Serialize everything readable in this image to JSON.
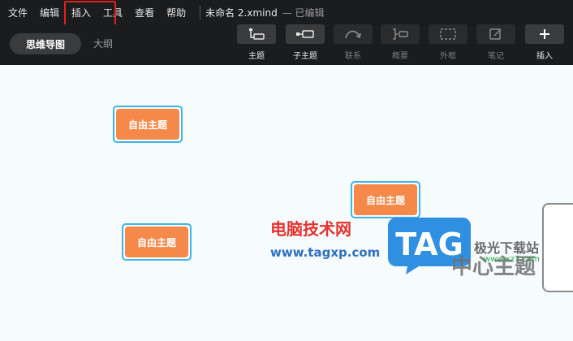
{
  "menu": {
    "items": [
      "文件",
      "编辑",
      "插入",
      "工具",
      "查看",
      "帮助"
    ],
    "doc_title": "未命名 2.xmind",
    "doc_status": "— 已编辑"
  },
  "view": {
    "mindmap_label": "思维导图",
    "outline_label": "大纲"
  },
  "toolbar": {
    "tools": [
      {
        "label": "主题",
        "icon": "topic-icon",
        "enabled": true
      },
      {
        "label": "子主题",
        "icon": "subtopic-icon",
        "enabled": true
      },
      {
        "label": "联系",
        "icon": "relationship-icon",
        "enabled": false
      },
      {
        "label": "概要",
        "icon": "summary-icon",
        "enabled": false
      },
      {
        "label": "外框",
        "icon": "boundary-icon",
        "enabled": false
      },
      {
        "label": "笔记",
        "icon": "note-icon",
        "enabled": false
      },
      {
        "label": "插入",
        "icon": "plus-icon",
        "enabled": true
      }
    ]
  },
  "canvas": {
    "floating_topics": [
      "自由主题",
      "自由主题",
      "自由主题"
    ],
    "central_topic": "中心主题"
  },
  "watermark": {
    "site_name": "电脑技术网",
    "site_url": "www.tagxp.com",
    "tag_text": "TAG",
    "brand_text": "极光下载站",
    "brand_url": "www.xz7.com"
  },
  "colors": {
    "topic_fill": "#f4894a",
    "topic_selection": "#3fb5e6",
    "highlight": "#e0221b",
    "menubar_bg": "#1b1c1e"
  }
}
